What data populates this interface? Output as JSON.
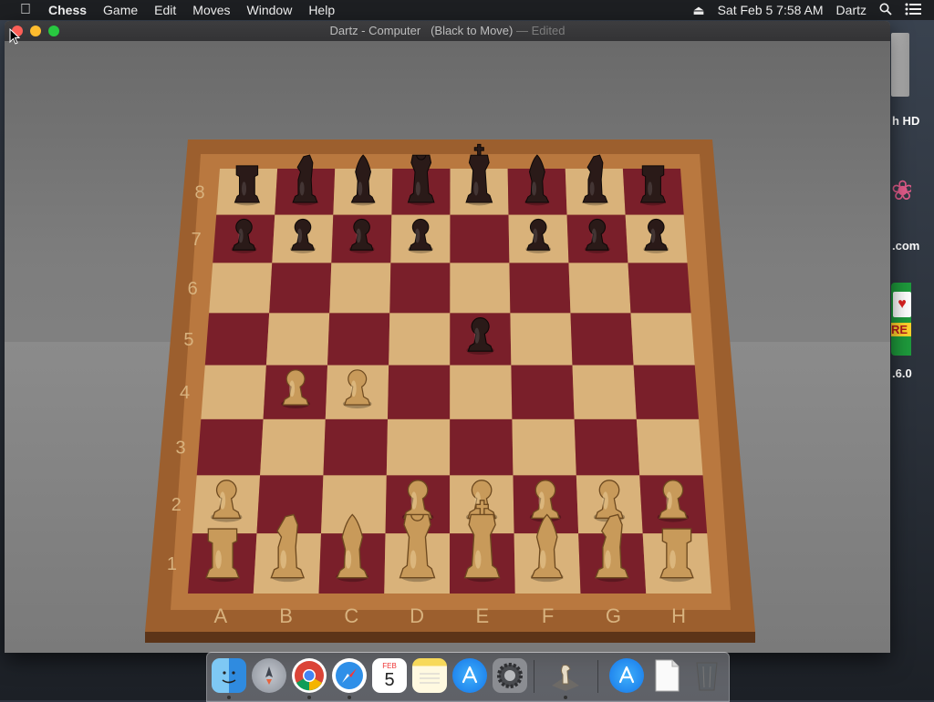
{
  "menubar": {
    "app_name": "Chess",
    "menus": [
      "Game",
      "Edit",
      "Moves",
      "Window",
      "Help"
    ],
    "datetime": "Sat Feb 5  7:58 AM",
    "user": "Dartz"
  },
  "desktop_icons": {
    "hd_label": "h HD",
    "com_label": ".com",
    "re_label": "RE",
    "version_label": ".6.0"
  },
  "window": {
    "title": "Dartz - Computer",
    "status": "(Black to Move)",
    "edited": "— Edited"
  },
  "board": {
    "files": [
      "A",
      "B",
      "C",
      "D",
      "E",
      "F",
      "G",
      "H"
    ],
    "ranks": [
      "8",
      "7",
      "6",
      "5",
      "4",
      "3",
      "2",
      "1"
    ],
    "light_square": "#d9b27a",
    "dark_square": "#7a1f2a",
    "frame_color": "#9c5f2e",
    "white_piece": "#c89a5a",
    "black_piece": "#2a1a18",
    "pieces": [
      {
        "square": "a8",
        "piece": "rook",
        "color": "black"
      },
      {
        "square": "b8",
        "piece": "knight",
        "color": "black"
      },
      {
        "square": "c8",
        "piece": "bishop",
        "color": "black"
      },
      {
        "square": "d8",
        "piece": "queen",
        "color": "black"
      },
      {
        "square": "e8",
        "piece": "king",
        "color": "black"
      },
      {
        "square": "f8",
        "piece": "bishop",
        "color": "black"
      },
      {
        "square": "g8",
        "piece": "knight",
        "color": "black"
      },
      {
        "square": "h8",
        "piece": "rook",
        "color": "black"
      },
      {
        "square": "a7",
        "piece": "pawn",
        "color": "black"
      },
      {
        "square": "b7",
        "piece": "pawn",
        "color": "black"
      },
      {
        "square": "c7",
        "piece": "pawn",
        "color": "black"
      },
      {
        "square": "d7",
        "piece": "pawn",
        "color": "black"
      },
      {
        "square": "f7",
        "piece": "pawn",
        "color": "black"
      },
      {
        "square": "g7",
        "piece": "pawn",
        "color": "black"
      },
      {
        "square": "h7",
        "piece": "pawn",
        "color": "black"
      },
      {
        "square": "e5",
        "piece": "pawn",
        "color": "black"
      },
      {
        "square": "b4",
        "piece": "pawn",
        "color": "white"
      },
      {
        "square": "c4",
        "piece": "pawn",
        "color": "white"
      },
      {
        "square": "a2",
        "piece": "pawn",
        "color": "white"
      },
      {
        "square": "d2",
        "piece": "pawn",
        "color": "white"
      },
      {
        "square": "e2",
        "piece": "pawn",
        "color": "white"
      },
      {
        "square": "f2",
        "piece": "pawn",
        "color": "white"
      },
      {
        "square": "g2",
        "piece": "pawn",
        "color": "white"
      },
      {
        "square": "h2",
        "piece": "pawn",
        "color": "white"
      },
      {
        "square": "a1",
        "piece": "rook",
        "color": "white"
      },
      {
        "square": "b1",
        "piece": "knight",
        "color": "white"
      },
      {
        "square": "c1",
        "piece": "bishop",
        "color": "white"
      },
      {
        "square": "d1",
        "piece": "queen",
        "color": "white"
      },
      {
        "square": "e1",
        "piece": "king",
        "color": "white"
      },
      {
        "square": "f1",
        "piece": "bishop",
        "color": "white"
      },
      {
        "square": "g1",
        "piece": "knight",
        "color": "white"
      },
      {
        "square": "h1",
        "piece": "rook",
        "color": "white"
      }
    ]
  },
  "dock": {
    "items": [
      {
        "icon": "finder-icon"
      },
      {
        "icon": "launchpad-icon"
      },
      {
        "icon": "chrome-icon"
      },
      {
        "icon": "safari-icon"
      },
      {
        "icon": "calendar-icon",
        "month": "FEB",
        "day": "5"
      },
      {
        "icon": "notes-icon"
      },
      {
        "icon": "app-store-icon"
      },
      {
        "icon": "system-preferences-icon"
      },
      {
        "icon": "chess-app-icon"
      },
      {
        "icon": "app-store-downloads-icon"
      },
      {
        "icon": "document-icon"
      },
      {
        "icon": "trash-icon"
      }
    ]
  }
}
